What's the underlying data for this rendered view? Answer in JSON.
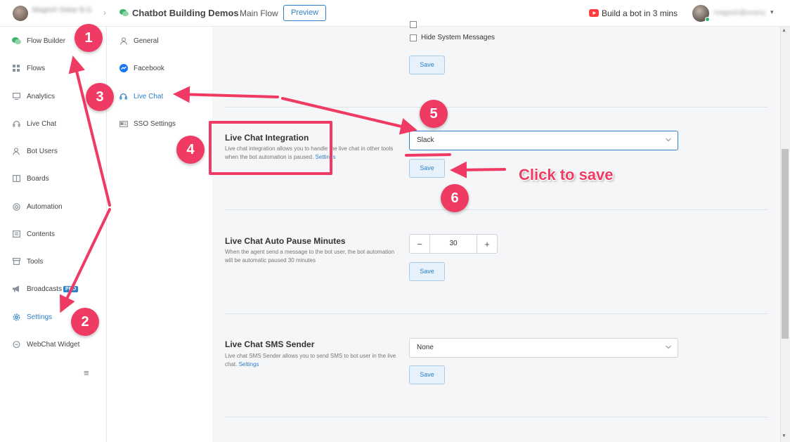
{
  "topbar": {
    "workspace_name": "Magesh Sekar B.G",
    "bot_name": "Chatbot Building Demos",
    "flow_name": "Main Flow",
    "preview_label": "Preview",
    "youtube_label": "Build a bot in 3 mins",
    "user_name": "magesh@example"
  },
  "sidebar": {
    "items": [
      {
        "label": "Flow Builder",
        "icon": "flow-builder-icon"
      },
      {
        "label": "Flows",
        "icon": "grid-icon"
      },
      {
        "label": "Analytics",
        "icon": "chart-icon"
      },
      {
        "label": "Live Chat",
        "icon": "headset-icon"
      },
      {
        "label": "Bot Users",
        "icon": "user-icon"
      },
      {
        "label": "Boards",
        "icon": "board-icon"
      },
      {
        "label": "Automation",
        "icon": "automation-icon"
      },
      {
        "label": "Contents",
        "icon": "contents-icon"
      },
      {
        "label": "Tools",
        "icon": "tools-icon"
      },
      {
        "label": "Broadcasts",
        "icon": "megaphone-icon",
        "badge": "PRO"
      },
      {
        "label": "Settings",
        "icon": "gear-icon",
        "active": true
      },
      {
        "label": "WebChat Widget",
        "icon": "chat-bubble-icon"
      }
    ]
  },
  "settings_nav": {
    "items": [
      {
        "label": "General",
        "icon": "user-icon"
      },
      {
        "label": "Facebook",
        "icon": "messenger-icon"
      },
      {
        "label": "Live Chat",
        "icon": "headset-icon",
        "active": true
      },
      {
        "label": "SSO Settings",
        "icon": "id-card-icon"
      }
    ]
  },
  "main": {
    "top_section": {
      "checkbox_hide_system": "Hide System Messages",
      "save_label": "Save"
    },
    "integration": {
      "title": "Live Chat Integration",
      "description": "Live chat integration allows you to handle the live chat in other tools when the bot automation is paused.",
      "link": "Settings",
      "selected": "Slack",
      "save_label": "Save"
    },
    "auto_pause": {
      "title": "Live Chat Auto Pause Minutes",
      "description": "When the agent send a message to the bot user, the bot automation will be automatic paused 30 minutes",
      "minus": "−",
      "value": "30",
      "plus": "+",
      "save_label": "Save"
    },
    "sms_sender": {
      "title": "Live Chat SMS Sender",
      "description": "Live chat SMS Sender allows you to send SMS to bot user in the live chat.",
      "link": "Settings",
      "selected": "None",
      "save_label": "Save"
    }
  },
  "annotations": {
    "badges": [
      "1",
      "2",
      "3",
      "4",
      "5",
      "6"
    ],
    "click_to_save": "Click to save",
    "color": "#ef3b63"
  },
  "colors": {
    "accent": "#2f80c8",
    "annotation": "#ef3b63",
    "youtube": "#ff3d3d"
  }
}
